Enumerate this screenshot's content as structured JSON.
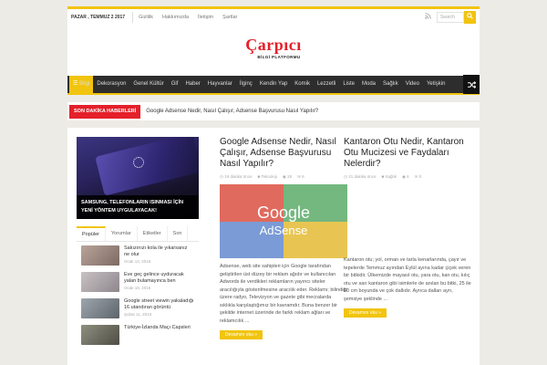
{
  "topbar": {
    "date": "PAZAR , TEMMUZ 2 2017",
    "links": [
      "Gizlilik",
      "Hakkımızda",
      "İletişim",
      "Şartlar"
    ],
    "search_placeholder": "Search",
    "rss_icon": "rss-icon",
    "search_icon": "search-icon"
  },
  "header": {
    "logo_main": "Çarpıcı",
    "logo_sub": "BİLGİ PLATFORMU",
    "logo_color": "#e4202a"
  },
  "nav": {
    "items": [
      "Bilgi",
      "Dekorasyon",
      "Genel Kültür",
      "Gif",
      "Haber",
      "Hayvanlar",
      "İlginç",
      "Kendin Yap",
      "Komik",
      "Lezzetli",
      "Liste",
      "Moda",
      "Sağlık",
      "Video",
      "Yetişkin"
    ],
    "accent": "#f1c40f"
  },
  "breaking": {
    "label": "SON DAKİKA HABERLERİ",
    "headline": "Google Adsense Nedir, Nasıl Çalışır, Adsense Başvurusu Nasıl Yapılır?"
  },
  "slider": {
    "caption": "SAMSUNG, TELEFONLARIN ISINMASI İÇİN YENİ YÖNTEM UYGULAYACAK!"
  },
  "widget": {
    "tabs": [
      "Popüler",
      "Yorumlar",
      "Etiketler",
      "Son"
    ],
    "items": [
      {
        "title": "Sakızınızı kola ile yıkarsanız ne olur",
        "date": "Ocak 13, 2016"
      },
      {
        "title": "Eve geç gelince uyduracak yalan bulamayınca ben",
        "date": "Ocak 18, 2016"
      },
      {
        "title": "Google street viewin yakaladığı 16 utandıran görüntü",
        "date": "Şubat 11, 2016"
      },
      {
        "title": "Türkiye-İzlanda Maçı Capsleri",
        "date": ""
      }
    ]
  },
  "articles": [
    {
      "title": "Google Adsense Nedir, Nasıl Çalışır, Adsense Başvurusu Nasıl Yapılır?",
      "time": "19 dakika önce",
      "category": "Teknoloji",
      "views": "25",
      "comments": "6",
      "image_word": "Google",
      "image_sub": "AdSense",
      "excerpt": "Adsense, web site sahipleri için Google tarafından geliştirilen üst düzey bir reklam ağıdır ve kullanıcıları Adwords ile verdikleri reklamların yayıncı siteler aracılığıyla gösterilmesine aracılık eder. Reklamı; bilindiği üzere radyo, Televizyon ve gazete gibi mecralarda sıklıkla karşılaştığımız bir kavramdır. Buna benzer bir şekilde internet üzerinde de farklı reklam ağları ve reklamcılık ...",
      "more": "Devamını oku »"
    },
    {
      "title": "Kantaron Otu Nedir, Kantaron Otu Mucizesi ve Faydaları Nelerdir?",
      "time": "21 dakika önce",
      "category": "Sağlık",
      "views": "6",
      "comments": "0",
      "excerpt": "Kantaron otu; yol, orman ve tarla kenarlarında, çayır ve tepelerde Temmuz ayından Eylül ayına kadar çiçek veren bir bitkidir. Ülkemizde mayasıl otu, yara otu, kan otu, kılıç otu ve sarı kantaron gibi isimlerle de anılan bu bitki, 25 ile 60 cm boyunda ve çok dallıdır. Ayrıca dalları ayrı, şemsiye şeklinde ...",
      "more": "Devamını oku »"
    }
  ]
}
